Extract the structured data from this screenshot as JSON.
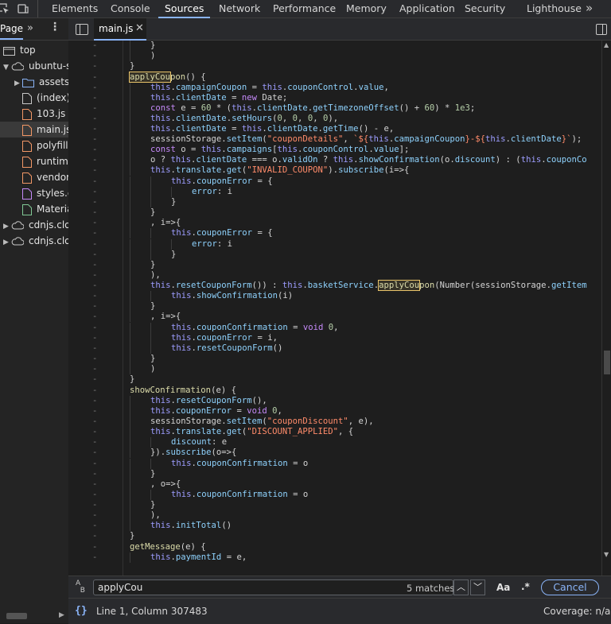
{
  "toolbar": {
    "tabs": [
      {
        "label": "Elements"
      },
      {
        "label": "Console"
      },
      {
        "label": "Sources"
      },
      {
        "label": "Network"
      },
      {
        "label": "Performance"
      },
      {
        "label": "Memory"
      },
      {
        "label": "Application"
      },
      {
        "label": "Security"
      },
      {
        "label": "Lighthouse"
      }
    ],
    "more_icon": "chevron-double-right-icon"
  },
  "navigator": {
    "tab_label": "Page",
    "tree": [
      {
        "label": "top",
        "icon": "frame-icon"
      },
      {
        "label": "ubuntu-se",
        "icon": "cloud-icon"
      },
      {
        "label": "assets/",
        "icon": "folder-icon"
      },
      {
        "label": "(index)",
        "icon": "file-icon"
      },
      {
        "label": "103.js",
        "icon": "js-file-icon"
      },
      {
        "label": "main.js",
        "icon": "js-file-icon"
      },
      {
        "label": "polyfills",
        "icon": "js-file-icon"
      },
      {
        "label": "runtime",
        "icon": "js-file-icon"
      },
      {
        "label": "vendor",
        "icon": "js-file-icon"
      },
      {
        "label": "styles.c",
        "icon": "css-file-icon"
      },
      {
        "label": "Materia",
        "icon": "font-file-icon"
      },
      {
        "label": "cdnjs.clo",
        "icon": "cloud-icon"
      },
      {
        "label": "cdnjs.clo",
        "icon": "cloud-icon"
      }
    ]
  },
  "editor": {
    "file_tab": "main.js",
    "gutter_marker": "-"
  },
  "search": {
    "value": "applyCou",
    "matches": "5 matches",
    "case_label": "Aa",
    "regex_label": ".*",
    "cancel_label": "Cancel"
  },
  "status": {
    "position": "Line 1, Column 307483",
    "coverage": "Coverage: n/a"
  }
}
